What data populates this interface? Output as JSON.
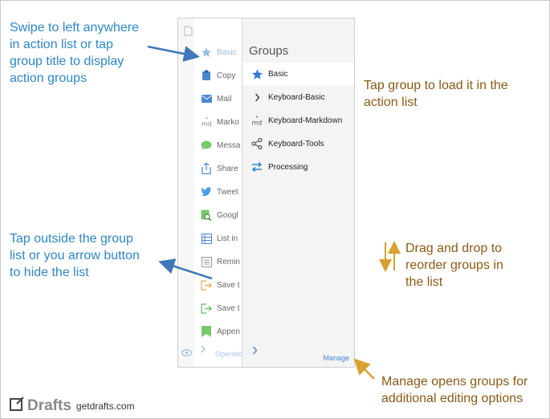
{
  "annotations": {
    "swipe": "Swipe to left anywhere\nin action list or tap\ngroup title to display\naction groups",
    "tap_outside": "Tap outside the group\nlist or you arrow button\nto hide the list",
    "tap_group": "Tap group to load it in the\naction list",
    "drag_drop": "Drag and drop to\nreorder groups in\nthe list",
    "manage_note": "Manage opens groups for\nadditional editing options"
  },
  "action_list": {
    "items": [
      {
        "label": "Basic",
        "icon": "star-icon"
      },
      {
        "label": "Copy",
        "icon": "clipboard-icon"
      },
      {
        "label": "Mail",
        "icon": "mail-icon"
      },
      {
        "label": "Marko",
        "icon": "markdown-icon"
      },
      {
        "label": "Messa",
        "icon": "message-icon"
      },
      {
        "label": "Share",
        "icon": "share-icon"
      },
      {
        "label": "Tweet",
        "icon": "twitter-icon"
      },
      {
        "label": "Googl",
        "icon": "google-search-icon"
      },
      {
        "label": "List in",
        "icon": "list-icon"
      },
      {
        "label": "Remin",
        "icon": "reminder-icon"
      },
      {
        "label": "Save t",
        "icon": "save-icon"
      },
      {
        "label": "Save t",
        "icon": "save-green-icon"
      },
      {
        "label": "Appen",
        "icon": "append-icon"
      }
    ],
    "operations_label": "Operatio"
  },
  "groups": {
    "title": "Groups",
    "items": [
      {
        "label": "Basic",
        "icon": "star-icon",
        "selected": true
      },
      {
        "label": "Keyboard-Basic",
        "icon": "chevron-right-icon"
      },
      {
        "label": "Keyboard-Markdown",
        "icon": "markdown-icon"
      },
      {
        "label": "Keyboard-Tools",
        "icon": "share-nodes-icon"
      },
      {
        "label": "Processing",
        "icon": "swap-arrows-icon"
      }
    ],
    "manage_label": "Manage"
  },
  "brand": {
    "name": "Drafts",
    "url": "getdrafts.com"
  },
  "colors": {
    "annotation_blue": "#2f86c6",
    "annotation_brown": "#8a5a16",
    "arrow_orange": "#d9a032",
    "star_blue": "#3a7bd5"
  }
}
